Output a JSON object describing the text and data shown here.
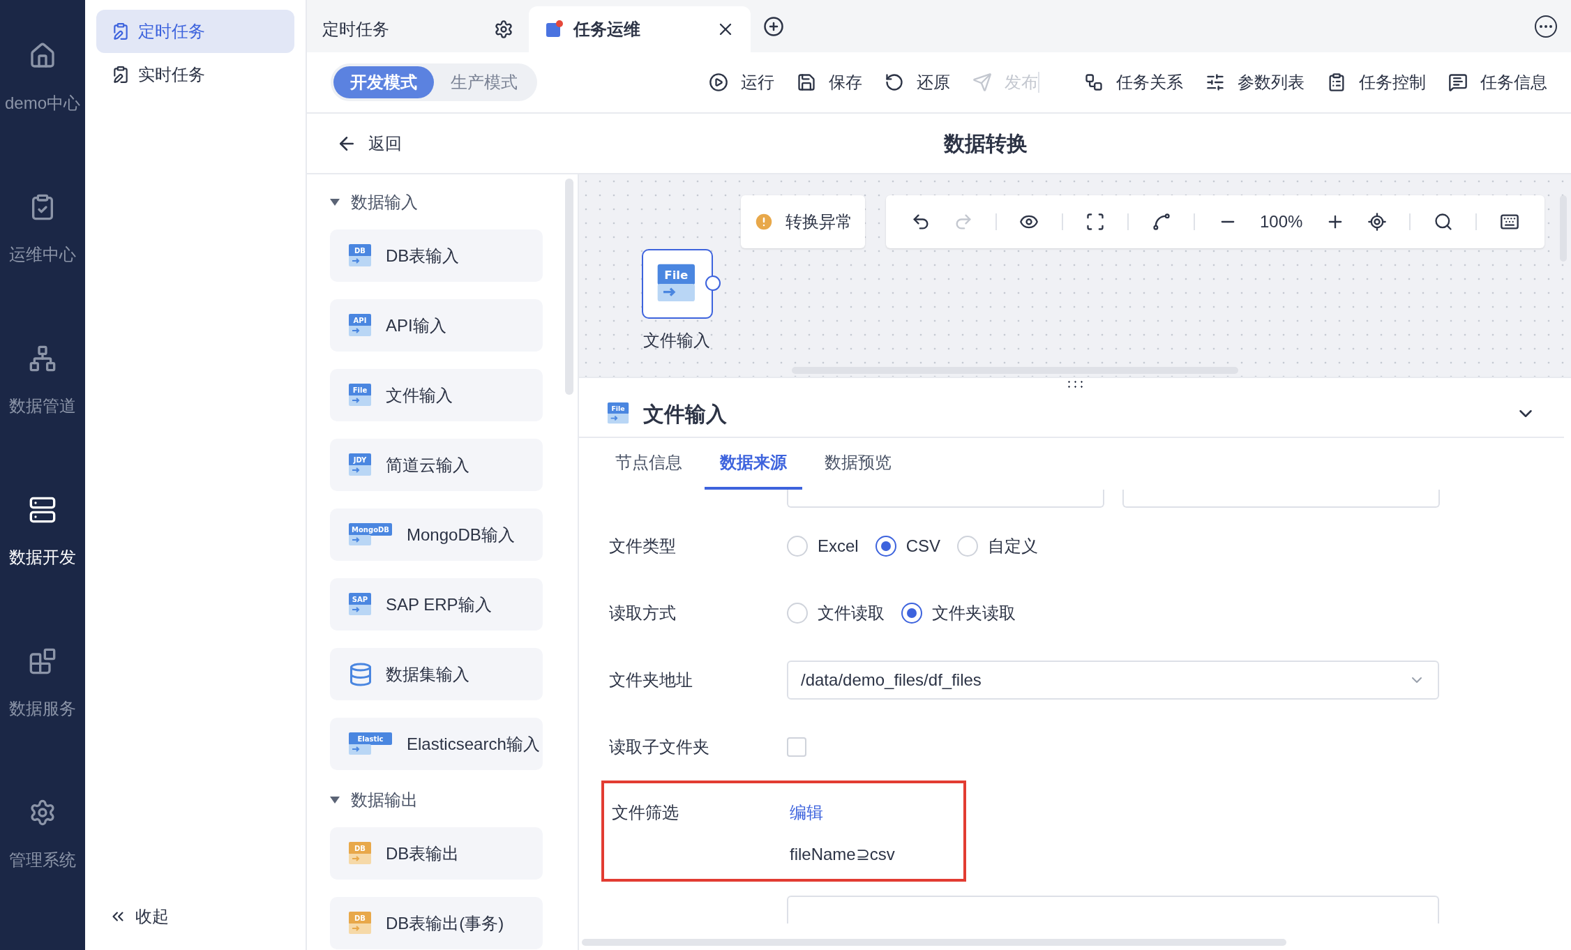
{
  "nav": [
    {
      "label": "demo中心",
      "kind": "home",
      "selected": false
    },
    {
      "label": "运维中心",
      "kind": "ops",
      "selected": false
    },
    {
      "label": "数据管道",
      "kind": "pipeline",
      "selected": false
    },
    {
      "label": "数据开发",
      "kind": "dev",
      "selected": true
    },
    {
      "label": "数据服务",
      "kind": "service",
      "selected": false
    },
    {
      "label": "管理系统",
      "kind": "settings",
      "selected": false
    }
  ],
  "subnav": {
    "items": [
      {
        "label": "定时任务",
        "selected": true
      },
      {
        "label": "实时任务",
        "selected": false
      }
    ],
    "collapse": "收起"
  },
  "tabs": [
    {
      "label": "定时任务",
      "kind": "settings",
      "selected": false
    },
    {
      "label": "任务运维",
      "kind": "closable",
      "selected": true
    }
  ],
  "modes": [
    {
      "label": "开发模式",
      "selected": true
    },
    {
      "label": "生产模式",
      "selected": false
    }
  ],
  "actions": [
    {
      "label": "运行",
      "kind": "run",
      "disabled": false
    },
    {
      "label": "保存",
      "kind": "save",
      "disabled": false
    },
    {
      "label": "还原",
      "kind": "restore",
      "disabled": false
    },
    {
      "label": "发布",
      "kind": "publish",
      "disabled": true
    },
    {
      "label": "任务关系",
      "kind": "relation",
      "disabled": false
    },
    {
      "label": "参数列表",
      "kind": "params",
      "disabled": false
    },
    {
      "label": "任务控制",
      "kind": "control",
      "disabled": false
    },
    {
      "label": "任务信息",
      "kind": "info",
      "disabled": false
    }
  ],
  "back": "返回",
  "title": "数据转换",
  "palette": [
    {
      "label": "数据输入",
      "expanded": true,
      "items": [
        {
          "label": "DB表输入",
          "kind": "input",
          "icon_text": "DB"
        },
        {
          "label": "API输入",
          "kind": "input",
          "icon_text": "API"
        },
        {
          "label": "文件输入",
          "kind": "input",
          "icon_text": "File"
        },
        {
          "label": "简道云输入",
          "kind": "input",
          "icon_text": "JDY"
        },
        {
          "label": "MongoDB输入",
          "kind": "input",
          "icon_text": "MongoDB"
        },
        {
          "label": "SAP ERP输入",
          "kind": "input",
          "icon_text": "SAP"
        },
        {
          "label": "数据集输入",
          "kind": "cloud"
        },
        {
          "label": "Elasticsearch输入",
          "kind": "input",
          "icon_text": "Elastic"
        }
      ]
    },
    {
      "label": "数据输出",
      "expanded": true,
      "items": [
        {
          "label": "DB表输出",
          "kind": "output",
          "icon_text": "DB"
        },
        {
          "label": "DB表输出(事务)",
          "kind": "output",
          "icon_text": "DB"
        }
      ]
    }
  ],
  "canvas": {
    "status": "转换异常",
    "zoom": "100%",
    "node": {
      "label": "文件输入",
      "icon_text": "File",
      "selected": true
    }
  },
  "panel": {
    "title": "文件输入",
    "icon_text": "File",
    "tabs": [
      {
        "label": "节点信息",
        "selected": false
      },
      {
        "label": "数据来源",
        "selected": true
      },
      {
        "label": "数据预览",
        "selected": false
      }
    ],
    "fields": [
      {
        "kind": "radio",
        "label": "文件类型",
        "options": [
          {
            "label": "Excel",
            "selected": false
          },
          {
            "label": "CSV",
            "selected": true
          },
          {
            "label": "自定义",
            "selected": false
          }
        ]
      },
      {
        "kind": "radio",
        "label": "读取方式",
        "options": [
          {
            "label": "文件读取",
            "selected": false
          },
          {
            "label": "文件夹读取",
            "selected": true
          }
        ]
      },
      {
        "kind": "select",
        "label": "文件夹地址",
        "value": "/data/demo_files/df_files"
      },
      {
        "kind": "checkbox",
        "label": "读取子文件夹",
        "checked": false
      },
      {
        "kind": "filter",
        "label": "文件筛选",
        "link": "编辑",
        "value": "fileName⊇csv",
        "highlighted": true
      }
    ]
  }
}
